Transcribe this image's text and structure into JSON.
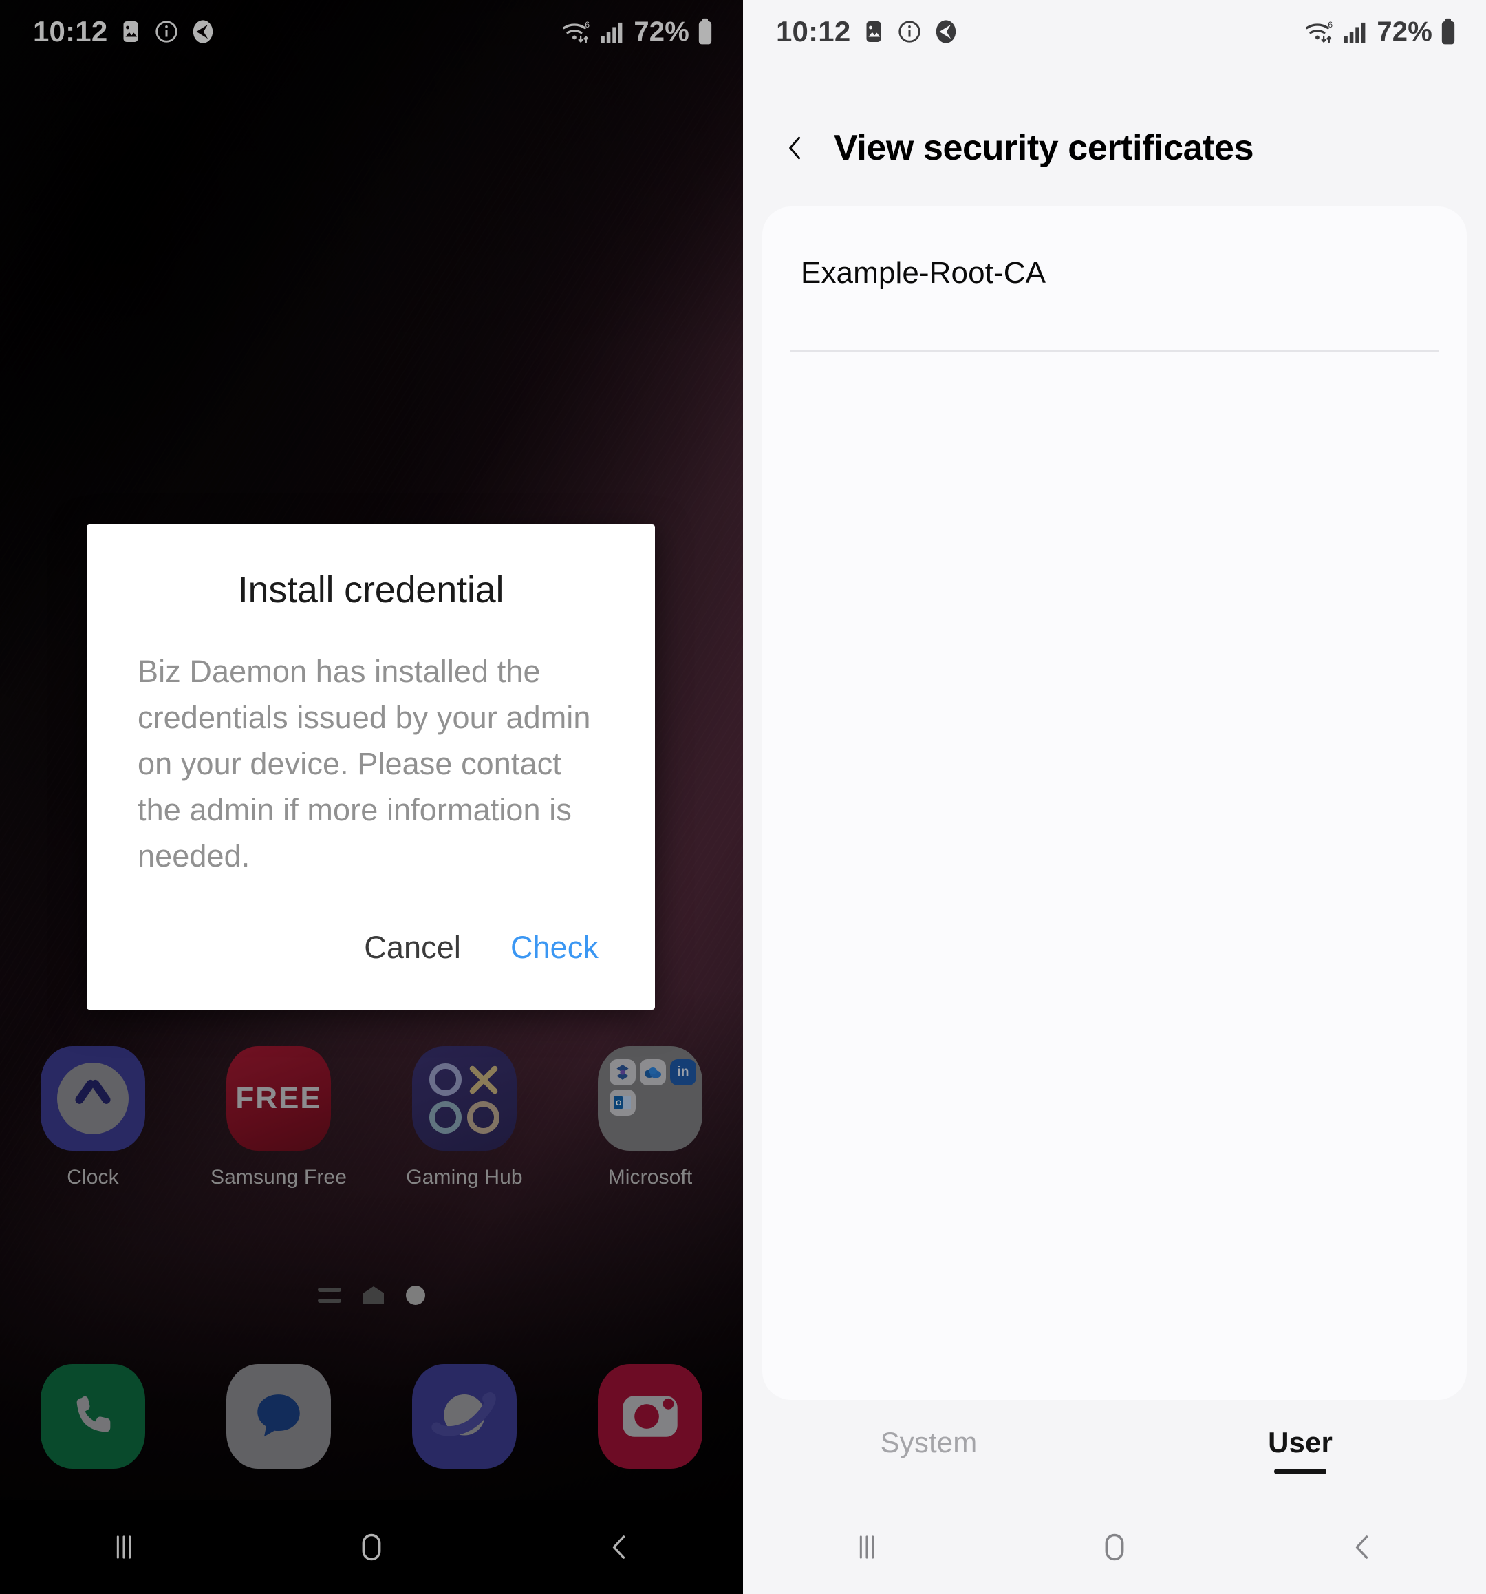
{
  "status_bar": {
    "time": "10:12",
    "icons_left": [
      "image-icon",
      "info-icon",
      "navigation-app-icon"
    ],
    "icons_right": [
      "wifi-6-icon",
      "cellular-signal-icon"
    ],
    "battery_percent": "72%",
    "battery_icon": "battery-icon"
  },
  "home_screen": {
    "dialog": {
      "title": "Install credential",
      "message": "Biz Daemon has installed the credentials issued by your admin on your device. Please contact the admin if more information is needed.",
      "cancel_label": "Cancel",
      "confirm_label": "Check",
      "confirm_color": "#3b97f3"
    },
    "apps": [
      {
        "label": "Clock",
        "icon": "clock-app-icon"
      },
      {
        "label": "Samsung Free",
        "icon": "samsung-free-app-icon",
        "icon_text": "FREE"
      },
      {
        "label": "Gaming Hub",
        "icon": "gaming-hub-app-icon"
      },
      {
        "label": "Microsoft",
        "icon": "microsoft-folder-icon"
      }
    ],
    "page_indicators": [
      "apps-list-icon",
      "home-page-icon",
      "current-page-dot"
    ],
    "dock": [
      {
        "label": "Phone",
        "icon": "phone-app-icon"
      },
      {
        "label": "Messages",
        "icon": "messages-app-icon"
      },
      {
        "label": "Internet",
        "icon": "internet-app-icon"
      },
      {
        "label": "Camera",
        "icon": "camera-app-icon"
      }
    ]
  },
  "settings_screen": {
    "back_icon": "back-chevron-icon",
    "title": "View security certificates",
    "certificates": [
      {
        "name": "Example-Root-CA"
      }
    ],
    "tabs": [
      {
        "label": "System",
        "active": false
      },
      {
        "label": "User",
        "active": true
      }
    ]
  },
  "nav_bar": {
    "recents_icon": "recents-icon",
    "home_icon": "home-icon",
    "back_icon": "back-icon"
  }
}
